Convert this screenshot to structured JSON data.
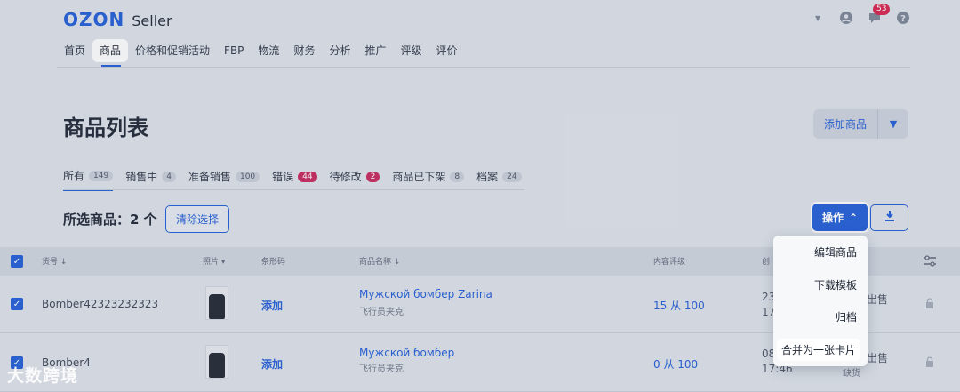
{
  "header": {
    "logo_brand": "OZON",
    "logo_product": "Seller",
    "notifications_count": "53"
  },
  "nav": [
    "首页",
    "商品",
    "价格和促销活动",
    "FBP",
    "物流",
    "财务",
    "分析",
    "推广",
    "评级",
    "评价"
  ],
  "page": {
    "title": "商品列表",
    "add_product": "添加商品"
  },
  "tabs": [
    {
      "label": "所有",
      "count": "149"
    },
    {
      "label": "销售中",
      "count": "4"
    },
    {
      "label": "准备销售",
      "count": "100"
    },
    {
      "label": "错误",
      "count": "44"
    },
    {
      "label": "待修改",
      "count": "2"
    },
    {
      "label": "商品已下架",
      "count": "8"
    },
    {
      "label": "档案",
      "count": "24"
    }
  ],
  "selection": {
    "label": "所选商品：2 个",
    "clear_button": "清除选择"
  },
  "actions": {
    "label": "操作",
    "menu": [
      "编辑商品",
      "下载模板",
      "归档",
      "合并为一张卡片"
    ]
  },
  "table": {
    "columns": [
      "货号",
      "照片",
      "条形码",
      "商品名称",
      "内容评级",
      "创"
    ],
    "rows": [
      {
        "sku": "Bomber42323232323",
        "barcode": "添加",
        "name": "Мужской бомбер Zarina",
        "subtitle": "飞行员夹克",
        "rating": "15 从 100",
        "date1": "23",
        "date2": "17",
        "status": "出售"
      },
      {
        "sku": "Bomber4",
        "barcode": "添加",
        "name": "Мужской бомбер",
        "subtitle": "飞行员夹克",
        "rating": "0 从 100",
        "date1": "08",
        "date2": "17:46",
        "status": "出售",
        "status_sub": "缺货"
      }
    ]
  },
  "watermark": "大数跨境"
}
